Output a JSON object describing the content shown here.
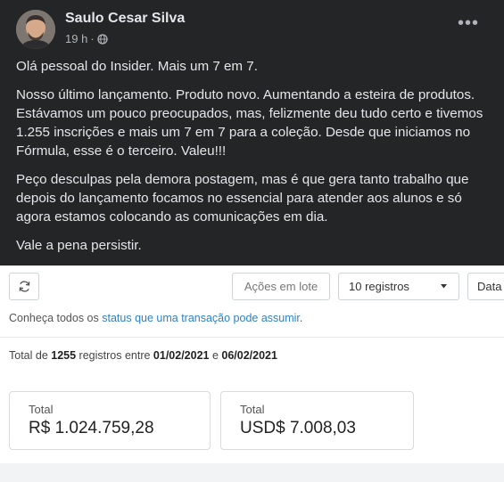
{
  "post": {
    "author": "Saulo Cesar Silva",
    "time": "19 h",
    "separator": "·",
    "paragraphs": [
      "Olá pessoal do Insider. Mais um 7 em 7.",
      "Nosso último lançamento. Produto novo. Aumentando a esteira de produtos. Estávamos um pouco preocupados, mas, felizmente deu tudo certo e tivemos 1.255 inscrições e mais um 7 em 7 para a coleção. Desde que iniciamos no Fórmula, esse é o terceiro. Valeu!!!",
      "Peço desculpas pela demora postagem, mas é que gera tanto trabalho que depois do lançamento focamos no essencial para atender aos alunos e só agora estamos colocando as comunicações em dia.",
      "Vale a pena persistir."
    ],
    "icons": {
      "privacy": "globe-icon",
      "menu": "more-options-icon"
    }
  },
  "panel": {
    "refresh_icon": "refresh-icon",
    "actions_label": "Ações em lote",
    "records_selected": "10 registros",
    "date_label": "Data",
    "hint": {
      "prefix": "Conheça todos os ",
      "link": "status que uma transação pode assumir",
      "suffix": "."
    },
    "summary": {
      "t1": "Total de ",
      "count": "1255",
      "t2": " registros entre ",
      "date_start": "01/02/2021",
      "t3": " e ",
      "date_end": "06/02/2021"
    },
    "cards": [
      {
        "label": "Total",
        "value": "R$ 1.024.759,28"
      },
      {
        "label": "Total",
        "value": "USD$ 7.008,03"
      }
    ]
  }
}
